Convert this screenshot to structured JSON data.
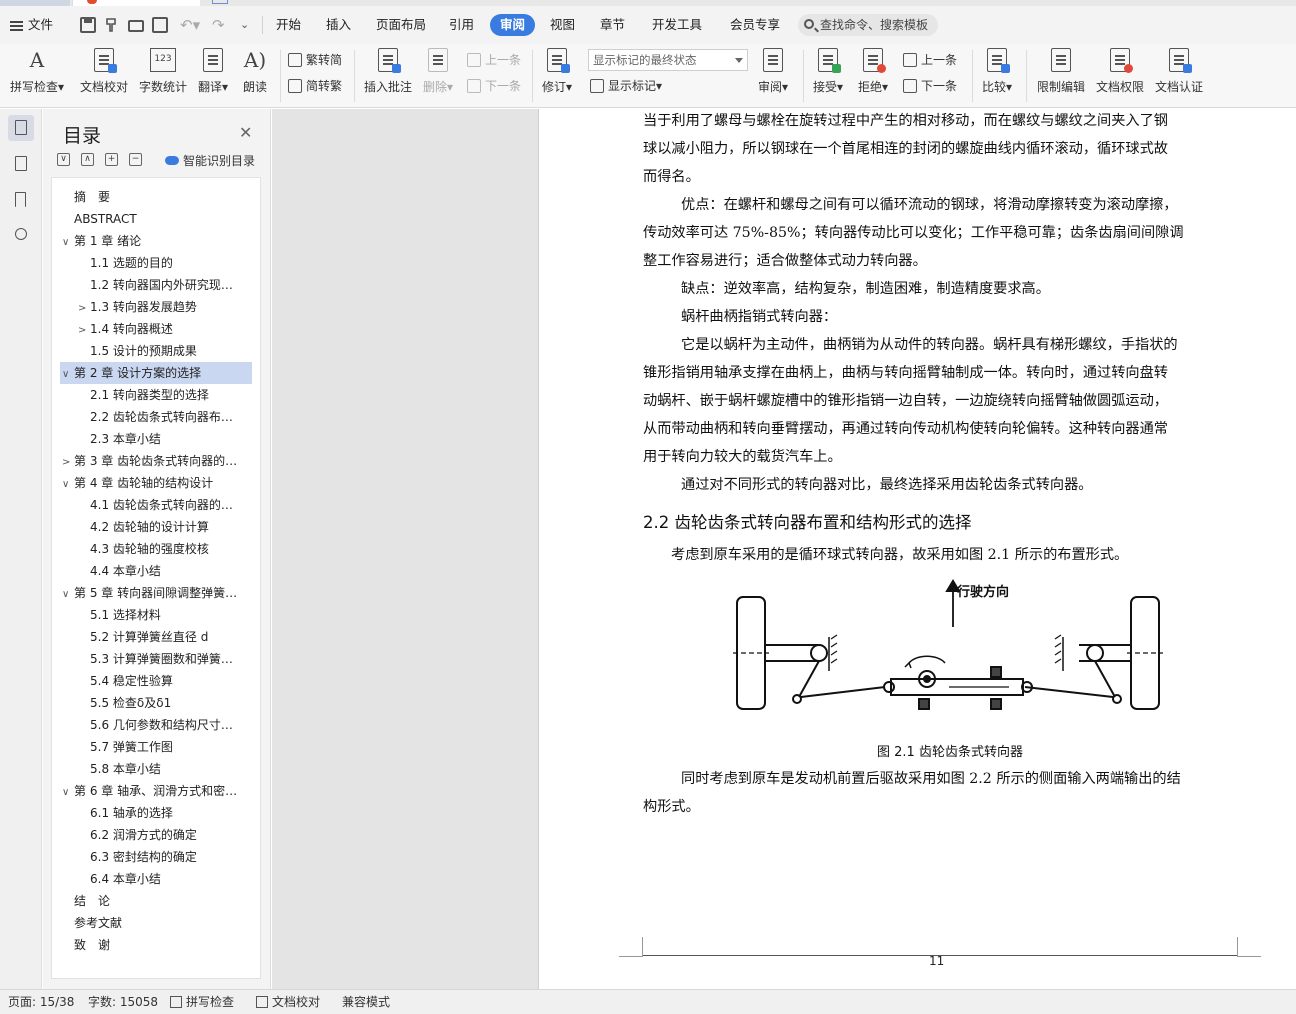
{
  "menu": {
    "file_label": "文件",
    "tabs": [
      "开始",
      "插入",
      "页面布局",
      "引用",
      "审阅",
      "视图",
      "章节",
      "开发工具",
      "会员专享"
    ],
    "active_tab": "审阅",
    "search_placeholder": "查找命令、搜索模板"
  },
  "ribbon": {
    "spell_check": "拼写检查",
    "doc_proof": "文档校对",
    "word_count": "字数统计",
    "translate": "翻译",
    "read_aloud": "朗读",
    "trad_simplified": "繁转简",
    "simplified_trad": "简转繁",
    "insert_comment": "插入批注",
    "delete": "删除",
    "prev_comment": "上一条",
    "next_comment": "下一条",
    "revise": "修订",
    "markup_combo": "显示标记的最终状态",
    "show_markup": "显示标记",
    "review": "审阅",
    "accept": "接受",
    "reject": "拒绝",
    "prev_change": "上一条",
    "next_change": "下一条",
    "compare": "比较",
    "restrict_edit": "限制编辑",
    "doc_permission": "文档权限",
    "doc_certify": "文档认证",
    "word_count_icon_text": "123"
  },
  "toc": {
    "title": "目录",
    "smart_label": "智能识别目录",
    "items": [
      {
        "label": "摘　要",
        "level": 1,
        "caret": ""
      },
      {
        "label": "ABSTRACT",
        "level": 1,
        "caret": ""
      },
      {
        "label": "第 1 章  绪论",
        "level": 1,
        "caret": "∨"
      },
      {
        "label": "1.1 选题的目的",
        "level": 2,
        "caret": ""
      },
      {
        "label": "1.2 转向器国内外研究现…",
        "level": 2,
        "caret": ""
      },
      {
        "label": "1.3 转向器发展趋势",
        "level": 2,
        "caret": ">"
      },
      {
        "label": "1.4 转向器概述",
        "level": 2,
        "caret": ">"
      },
      {
        "label": "1.5 设计的预期成果",
        "level": 2,
        "caret": ""
      },
      {
        "label": "第 2 章  设计方案的选择",
        "level": 1,
        "caret": "∨",
        "selected": true
      },
      {
        "label": "2.1 转向器类型的选择",
        "level": 2,
        "caret": ""
      },
      {
        "label": "2.2 齿轮齿条式转向器布…",
        "level": 2,
        "caret": ""
      },
      {
        "label": "2.3 本章小结",
        "level": 2,
        "caret": ""
      },
      {
        "label": "第 3 章  齿轮齿条式转向器的…",
        "level": 1,
        "caret": ">"
      },
      {
        "label": "第 4 章  齿轮轴的结构设计",
        "level": 1,
        "caret": "∨"
      },
      {
        "label": "4.1 齿轮齿条式转向器的…",
        "level": 2,
        "caret": ""
      },
      {
        "label": "4.2 齿轮轴的设计计算",
        "level": 2,
        "caret": ""
      },
      {
        "label": "4.3 齿轮轴的强度校核",
        "level": 2,
        "caret": ""
      },
      {
        "label": "4.4 本章小结",
        "level": 2,
        "caret": ""
      },
      {
        "label": "第 5 章  转向器间隙调整弹簧…",
        "level": 1,
        "caret": "∨"
      },
      {
        "label": "5.1 选择材料",
        "level": 2,
        "caret": ""
      },
      {
        "label": "5.2 计算弹簧丝直径 d",
        "level": 2,
        "caret": ""
      },
      {
        "label": "5.3 计算弹簧圈数和弹簧…",
        "level": 2,
        "caret": ""
      },
      {
        "label": "5.4 稳定性验算",
        "level": 2,
        "caret": ""
      },
      {
        "label": "5.5 检查δ及δ1",
        "level": 2,
        "caret": ""
      },
      {
        "label": "5.6 几何参数和结构尺寸…",
        "level": 2,
        "caret": ""
      },
      {
        "label": "5.7 弹簧工作图",
        "level": 2,
        "caret": ""
      },
      {
        "label": "5.8 本章小结",
        "level": 2,
        "caret": ""
      },
      {
        "label": "第 6 章  轴承、润滑方式和密…",
        "level": 1,
        "caret": "∨"
      },
      {
        "label": "6.1 轴承的选择",
        "level": 2,
        "caret": ""
      },
      {
        "label": "6.2 润滑方式的确定",
        "level": 2,
        "caret": ""
      },
      {
        "label": "6.3 密封结构的确定",
        "level": 2,
        "caret": ""
      },
      {
        "label": "6.4 本章小结",
        "level": 2,
        "caret": ""
      },
      {
        "label": "结　论",
        "level": 1,
        "caret": ""
      },
      {
        "label": "参考文献",
        "level": 1,
        "caret": ""
      },
      {
        "label": "致　谢",
        "level": 1,
        "caret": ""
      }
    ]
  },
  "document": {
    "lines_a": [
      {
        "text": "当于利用了螺母与螺栓在旋转过程中产生的相对移动，而在螺纹与螺纹之间夹入了钢",
        "indent": 0
      },
      {
        "text": "球以减小阻力，所以钢球在一个首尾相连的封闭的螺旋曲线内循环滚动，循环球式故",
        "indent": 0
      },
      {
        "text": "而得名。",
        "indent": 0
      },
      {
        "text": "优点：在螺杆和螺母之间有可以循环流动的钢球，将滑动摩擦转变为滚动摩擦，",
        "indent": 1
      },
      {
        "text": "传动效率可达 75%-85%；转向器传动比可以变化；工作平稳可靠；齿条齿扇间间隙调",
        "indent": 0
      },
      {
        "text": "整工作容易进行；适合做整体式动力转向器。",
        "indent": 0
      },
      {
        "text": "缺点：逆效率高，结构复杂，制造困难，制造精度要求高。",
        "indent": 1
      },
      {
        "text": "蜗杆曲柄指销式转向器：",
        "indent": 1
      },
      {
        "text": "它是以蜗杆为主动件，曲柄销为从动件的转向器。蜗杆具有梯形螺纹，手指状的",
        "indent": 1
      },
      {
        "text": "锥形指销用轴承支撑在曲柄上，曲柄与转向摇臂轴制成一体。转向时，通过转向盘转",
        "indent": 0
      },
      {
        "text": "动蜗杆、嵌于蜗杆螺旋槽中的锥形指销一边自转，一边旋绕转向摇臂轴做圆弧运动，",
        "indent": 0
      },
      {
        "text": "从而带动曲柄和转向垂臂摆动，再通过转向传动机构使转向轮偏转。这种转向器通常",
        "indent": 0
      },
      {
        "text": "用于转向力较大的载货汽车上。",
        "indent": 0
      },
      {
        "text": "通过对不同形式的转向器对比，最终选择采用齿轮齿条式转向器。",
        "indent": 1
      }
    ],
    "heading": "2.2 齿轮齿条式转向器布置和结构形式的选择",
    "para_after_heading": "考虑到原车采用的是循环球式转向器，故采用如图 2.1 所示的布置形式。",
    "figure_label": "行驶方向",
    "figure_caption": "图 2.1 齿轮齿条式转向器",
    "lines_b": [
      {
        "text": "同时考虑到原车是发动机前置后驱故采用如图 2.2 所示的侧面输入两端输出的结",
        "indent": 1
      },
      {
        "text": "构形式。",
        "indent": 0
      }
    ],
    "page_number": "11"
  },
  "status": {
    "page": "页面: 15/38",
    "words": "字数: 15058",
    "spell": "拼写检查",
    "proof": "文档校对",
    "compat": "兼容模式"
  }
}
